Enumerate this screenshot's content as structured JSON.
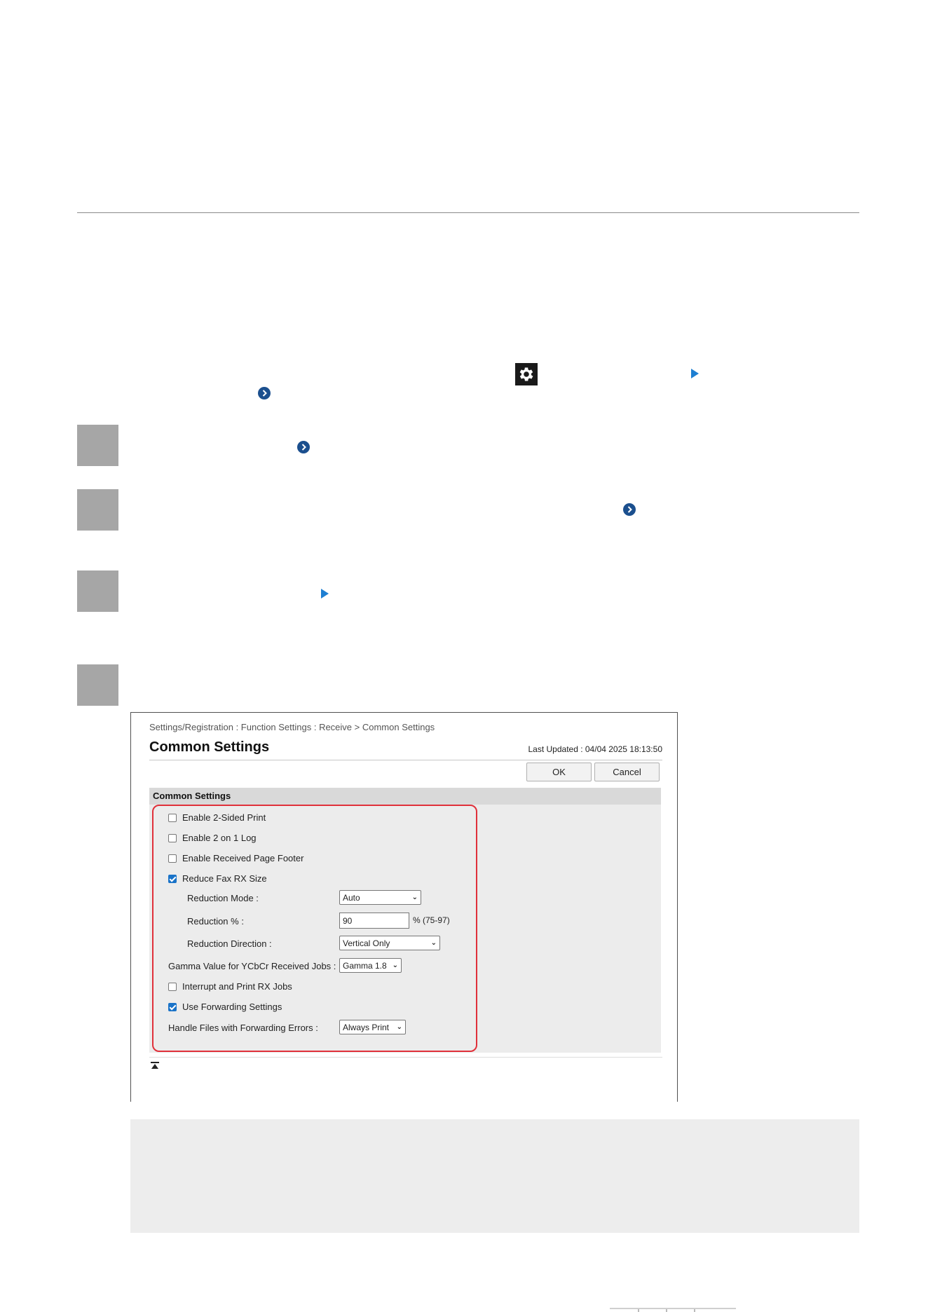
{
  "screenshot": {
    "breadcrumb": "Settings/Registration : Function Settings : Receive > Common Settings",
    "title": "Common Settings",
    "last_updated": "Last Updated : 04/04 2025 18:13:50",
    "ok_label": "OK",
    "cancel_label": "Cancel",
    "section_header": "Common Settings",
    "options": {
      "two_sided": {
        "label": "Enable 2-Sided Print",
        "checked": false
      },
      "two_on_one": {
        "label": "Enable 2 on 1 Log",
        "checked": false
      },
      "page_footer": {
        "label": "Enable Received Page Footer",
        "checked": false
      },
      "reduce_size": {
        "label": "Reduce Fax RX Size",
        "checked": true
      },
      "interrupt": {
        "label": "Interrupt and Print RX Jobs",
        "checked": false
      },
      "forwarding": {
        "label": "Use Forwarding Settings",
        "checked": true
      }
    },
    "reduction_mode": {
      "label": "Reduction Mode :",
      "value": "Auto"
    },
    "reduction_percent": {
      "label": "Reduction % :",
      "value": "90",
      "range": "% (75-97)"
    },
    "reduction_direction": {
      "label": "Reduction Direction :",
      "value": "Vertical Only"
    },
    "gamma": {
      "label": "Gamma Value for YCbCr Received Jobs :",
      "value": "Gamma 1.8"
    },
    "forward_errors": {
      "label": "Handle Files with Forwarding Errors :",
      "value": "Always Print"
    }
  },
  "colors": {
    "accent_blue": "#1e7fd2",
    "step_gray": "#a6a6a6",
    "highlight_red": "#e0303a"
  }
}
